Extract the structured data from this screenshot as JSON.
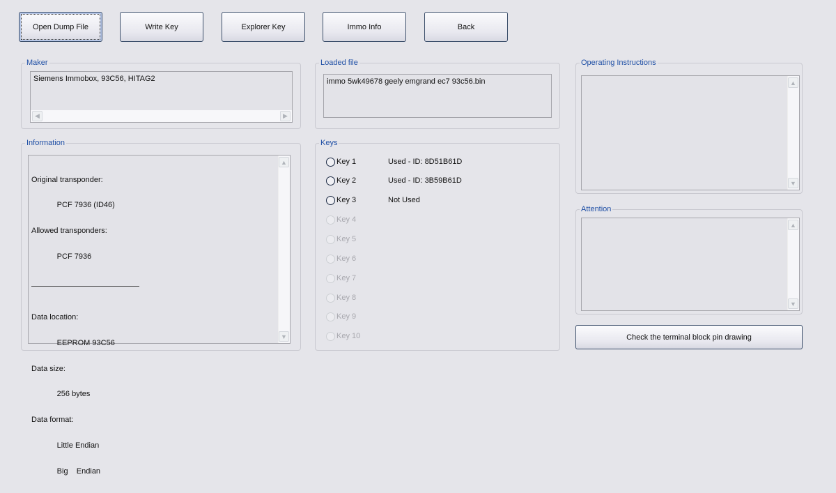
{
  "toolbar": {
    "buttons": [
      "Open Dump File",
      "Write Key",
      "Explorer Key",
      "Immo Info",
      "Back"
    ]
  },
  "maker": {
    "label": "Maker",
    "value": "Siemens Immobox, 93C56, HITAG2"
  },
  "loaded_file": {
    "label": "Loaded file",
    "value": "immo 5wk49678 geely emgrand ec7 93c56.bin"
  },
  "information": {
    "label": "Information",
    "lines": [
      "Original transponder:",
      "            PCF 7936 (ID46)",
      "Allowed transponders:",
      "            PCF 7936",
      "",
      "Data location:",
      "            EEPROM 93C56",
      "Data size:",
      "            256 bytes",
      "Data format:",
      "            Little Endian",
      "            Big    Endian"
    ],
    "separator": "————————————"
  },
  "keys": {
    "label": "Keys",
    "items": [
      {
        "label": "Key 1",
        "status": "Used - ID: 8D51B61D",
        "enabled": true
      },
      {
        "label": "Key 2",
        "status": "Used - ID: 3B59B61D",
        "enabled": true
      },
      {
        "label": "Key 3",
        "status": "Not Used",
        "enabled": true
      },
      {
        "label": "Key 4",
        "status": "",
        "enabled": false
      },
      {
        "label": "Key 5",
        "status": "",
        "enabled": false
      },
      {
        "label": "Key 6",
        "status": "",
        "enabled": false
      },
      {
        "label": "Key 7",
        "status": "",
        "enabled": false
      },
      {
        "label": "Key 8",
        "status": "",
        "enabled": false
      },
      {
        "label": "Key 9",
        "status": "",
        "enabled": false
      },
      {
        "label": "Key 10",
        "status": "",
        "enabled": false
      }
    ]
  },
  "operating_instructions": {
    "label": "Operating Instructions",
    "value": ""
  },
  "attention": {
    "label": "Attention",
    "value": ""
  },
  "check_button": "Check the terminal block pin drawing"
}
